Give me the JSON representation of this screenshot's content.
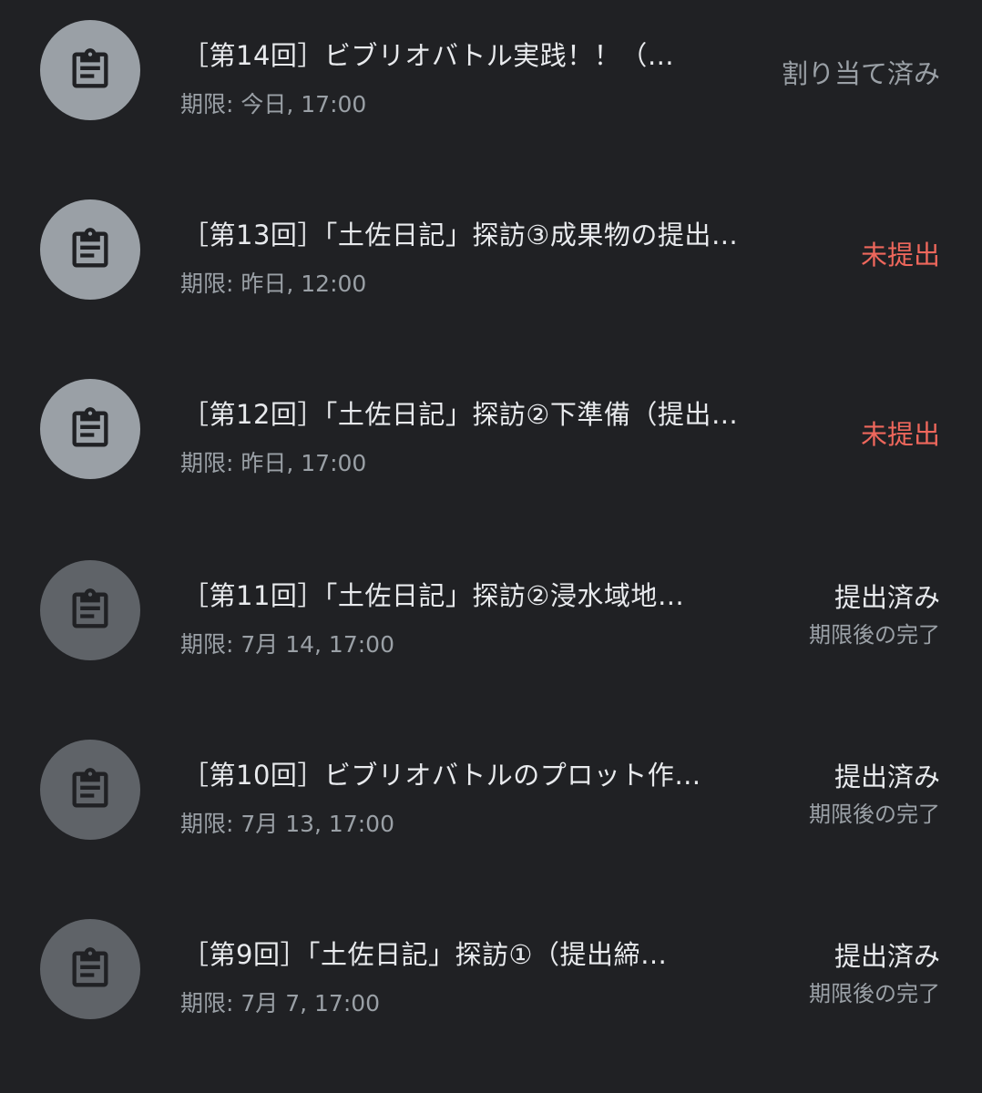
{
  "colors": {
    "background": "#202124",
    "title_text": "#e8eaed",
    "secondary_text": "#9aa0a6",
    "missing": "#ee675c",
    "avatar_active": "#9aa0a6",
    "avatar_done": "#5f6368",
    "icon": "#202124"
  },
  "assignments": [
    {
      "icon": "clipboard-icon",
      "title": "［第14回］ビブリオバトル実践！！（…",
      "due": "期限: 今日, 17:00",
      "status": "割り当て済み",
      "status_sub": ""
    },
    {
      "icon": "clipboard-icon",
      "title": "［第13回］「土佐日記」探訪③成果物の提出…",
      "due": "期限: 昨日, 12:00",
      "status": "未提出",
      "status_sub": ""
    },
    {
      "icon": "clipboard-icon",
      "title": "［第12回］「土佐日記」探訪②下準備（提出…",
      "due": "期限: 昨日, 17:00",
      "status": "未提出",
      "status_sub": ""
    },
    {
      "icon": "clipboard-icon",
      "title": "［第11回］「土佐日記」探訪②浸水域地…",
      "due": "期限: 7月 14, 17:00",
      "status": "提出済み",
      "status_sub": "期限後の完了"
    },
    {
      "icon": "clipboard-icon",
      "title": "［第10回］ビブリオバトルのプロット作…",
      "due": "期限: 7月 13, 17:00",
      "status": "提出済み",
      "status_sub": "期限後の完了"
    },
    {
      "icon": "clipboard-icon",
      "title": "［第9回］「土佐日記」探訪①（提出締…",
      "due": "期限: 7月 7, 17:00",
      "status": "提出済み",
      "status_sub": "期限後の完了"
    }
  ]
}
